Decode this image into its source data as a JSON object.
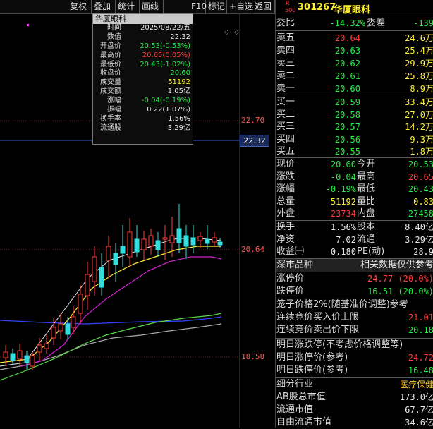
{
  "toolbar": {
    "items": [
      "复权",
      "叠加",
      "统计",
      "画线",
      "F10",
      "标记",
      "+自选",
      "返回"
    ]
  },
  "chart": {
    "price_high": "22.70",
    "price_mid": "20.64",
    "price_low": "18.58",
    "current": "22.32",
    "tooltip": {
      "title": "华厦眼科",
      "rows": [
        {
          "k": "时间",
          "v": "2025/08/22/五",
          "c": "white"
        },
        {
          "k": "数值",
          "v": "22.32",
          "c": "white"
        },
        {
          "k": "开盘价",
          "v": "20.53(-0.53%)",
          "c": "green"
        },
        {
          "k": "最高价",
          "v": "20.65(0.05%)",
          "c": "red"
        },
        {
          "k": "最低价",
          "v": "20.43(-1.02%)",
          "c": "green"
        },
        {
          "k": "收盘价",
          "v": "20.60",
          "c": "green"
        },
        {
          "k": "成交量",
          "v": "51192",
          "c": "yellow"
        },
        {
          "k": "成交额",
          "v": "1.05亿",
          "c": "white"
        },
        {
          "k": "涨幅",
          "v": "-0.04(-0.19%)",
          "c": "green"
        },
        {
          "k": "振幅",
          "v": "0.22(1.07%)",
          "c": "white"
        },
        {
          "k": "换手率",
          "v": "1.56%",
          "c": "white"
        },
        {
          "k": "流通股",
          "v": "3.29亿",
          "c": "white"
        }
      ]
    }
  },
  "panel": {
    "badge": "R 500",
    "code": "301267",
    "name": "华厦眼科",
    "weibi_label": "委比",
    "weibi": "-14.32%",
    "weicha_label": "委差",
    "weicha": "-139",
    "asks": [
      {
        "l": "卖五",
        "p": "20.64",
        "v": "24.6万",
        "pc": "red"
      },
      {
        "l": "卖四",
        "p": "20.63",
        "v": "25.4万",
        "pc": "green"
      },
      {
        "l": "卖三",
        "p": "20.62",
        "v": "29.9万",
        "pc": "green"
      },
      {
        "l": "卖二",
        "p": "20.61",
        "v": "25.8万",
        "pc": "green"
      },
      {
        "l": "卖一",
        "p": "20.60",
        "v": "8.9万",
        "pc": "green"
      }
    ],
    "bids": [
      {
        "l": "买一",
        "p": "20.59",
        "v": "33.4万"
      },
      {
        "l": "买二",
        "p": "20.58",
        "v": "27.0万"
      },
      {
        "l": "买三",
        "p": "20.57",
        "v": "14.2万"
      },
      {
        "l": "买四",
        "p": "20.56",
        "v": "9.3万"
      },
      {
        "l": "买五",
        "p": "20.55",
        "v": "1.8万"
      }
    ],
    "quote": [
      {
        "l1": "现价",
        "v1": "20.60",
        "c1": "green",
        "l2": "今开",
        "v2": "20.53",
        "c2": "green"
      },
      {
        "l1": "涨跌",
        "v1": "-0.04",
        "c1": "green",
        "l2": "最高",
        "v2": "20.65",
        "c2": "red"
      },
      {
        "l1": "涨幅",
        "v1": "-0.19%",
        "c1": "green",
        "l2": "最低",
        "v2": "20.43",
        "c2": "green"
      },
      {
        "l1": "总量",
        "v1": "51192",
        "c1": "yellow",
        "l2": "量比",
        "v2": "0.83",
        "c2": "yellow"
      },
      {
        "l1": "外盘",
        "v1": "23734",
        "c1": "red",
        "l2": "内盘",
        "v2": "27458",
        "c2": "green"
      }
    ],
    "fund": [
      {
        "l1": "换手",
        "v1": "1.56%",
        "l2": "股本",
        "v2": "8.40亿"
      },
      {
        "l1": "净资",
        "v1": "7.02",
        "l2": "流通",
        "v2": "3.29亿"
      },
      {
        "l1": "收益㈠",
        "v1": "0.180",
        "l2": "PE(动)",
        "v2": "28.9"
      }
    ],
    "market": {
      "l": "深市品种",
      "r": "相关数据仅供参考"
    },
    "limits": [
      {
        "l": "涨停价",
        "v": "24.77 (20.0%)",
        "c": "red"
      },
      {
        "l": "跌停价",
        "v": "16.51 (20.0%)",
        "c": "green"
      }
    ],
    "cage": {
      "title": "笼子价格2%(随基准价调整)参考",
      "rows": [
        {
          "l": "连续竞价买入价上限",
          "v": "21.01",
          "c": "red"
        },
        {
          "l": "连续竞价卖出价下限",
          "v": "20.18",
          "c": "green"
        }
      ]
    },
    "tomorrow": {
      "title": "明日涨跌停(不考虑价格调整等)",
      "rows": [
        {
          "l": "明日涨停价(参考)",
          "v": "24.72",
          "c": "red"
        },
        {
          "l": "明日跌停价(参考)",
          "v": "16.48",
          "c": "green"
        }
      ]
    },
    "industry": [
      {
        "l": "细分行业",
        "v": "医疗保健",
        "c": "orange"
      },
      {
        "l": "AB股总市值",
        "v": "173.0亿",
        "c": "white"
      },
      {
        "l": "流通市值",
        "v": "67.7亿",
        "c": "white"
      },
      {
        "l": "自由流通市值",
        "v": "34.6亿",
        "c": "white"
      }
    ]
  }
}
